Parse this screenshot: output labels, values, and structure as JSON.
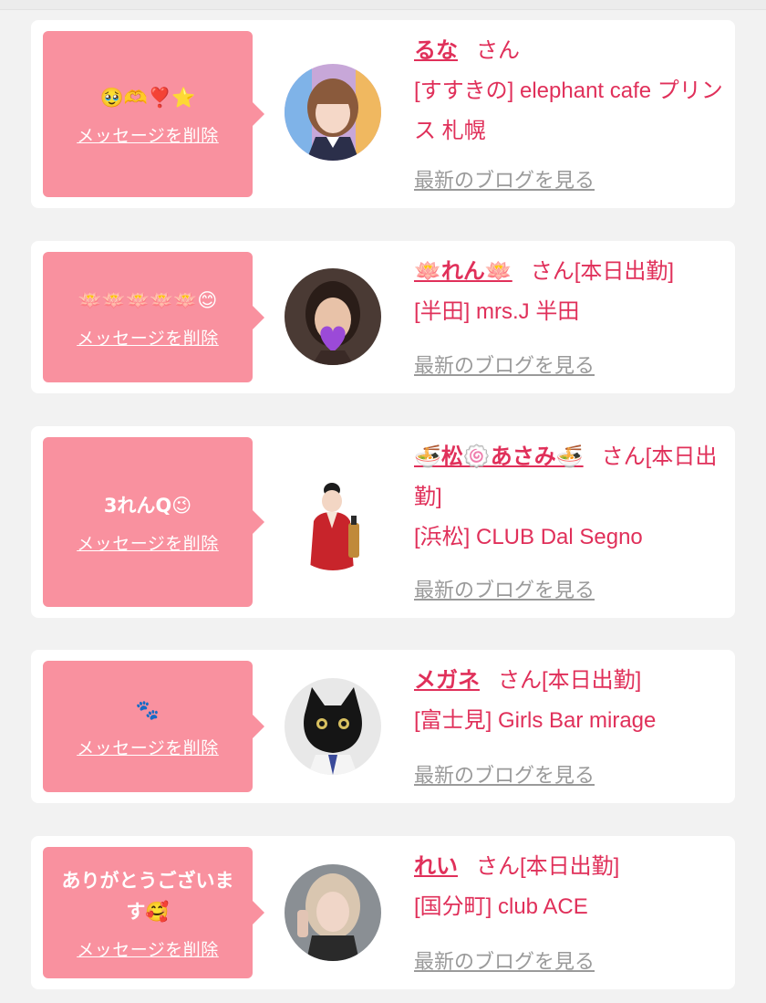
{
  "common": {
    "delete_label": "メッセージを削除",
    "blog_label": "最新のブログを見る",
    "san_label": "さん"
  },
  "colors": {
    "accent": "#e0305a",
    "bubble": "#f9919f",
    "background": "#f2f2f2",
    "link_gray": "#9a9a9a"
  },
  "items": [
    {
      "message": "🥹🫶❣️⭐",
      "name": "るな",
      "status": "",
      "shop": "[すすきの] elephant cafe プリンス 札幌",
      "avatar_icon": "girl-portrait-avatar"
    },
    {
      "message": "🪷🪷🪷🪷🪷😊",
      "name": "🪷れん🪷",
      "status": "[本日出勤]",
      "shop": "[半田] mrs.J 半田",
      "avatar_icon": "woman-heart-avatar"
    },
    {
      "message": "3れんQ😉",
      "name": "🍜松🍥あさみ🍜",
      "status": "[本日出勤]",
      "shop": "[浜松] CLUB Dal Segno",
      "avatar_icon": "kimono-woman-avatar"
    },
    {
      "message": "🐾",
      "name": "メガネ",
      "status": "[本日出勤]",
      "shop": "[富士見] Girls Bar mirage",
      "avatar_icon": "black-cat-avatar"
    },
    {
      "message": "ありがとうございます🥰",
      "name": "れい",
      "status": "[本日出勤]",
      "shop": "[国分町] club ACE",
      "avatar_icon": "woman-selfie-avatar"
    }
  ]
}
